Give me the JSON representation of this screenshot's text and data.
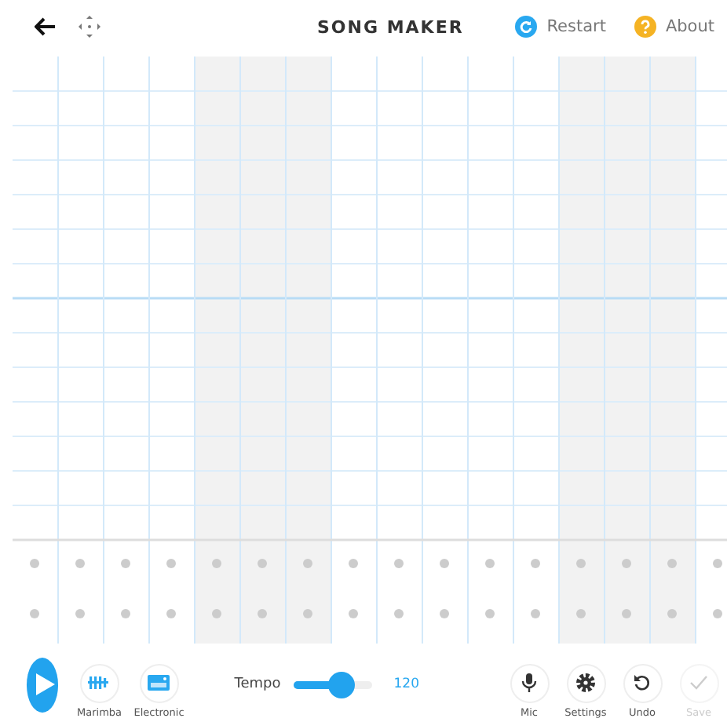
{
  "header": {
    "title": "SONG MAKER",
    "links": [
      {
        "kind": "restart",
        "label": "Restart"
      },
      {
        "kind": "about",
        "label": "About"
      }
    ]
  },
  "toolbar": {
    "instruments": [
      {
        "kind": "marimba",
        "label": "Marimba"
      },
      {
        "kind": "electronic",
        "label": "Electronic"
      }
    ],
    "tempo": {
      "label": "Tempo",
      "level": 0.62,
      "value": "120"
    },
    "actions": [
      {
        "kind": "mic",
        "label": "Mic",
        "disabled": false
      },
      {
        "kind": "settings",
        "label": "Settings",
        "disabled": false
      },
      {
        "kind": "undo",
        "label": "Undo",
        "disabled": false
      },
      {
        "kind": "save",
        "label": "Save",
        "disabled": true
      }
    ]
  }
}
